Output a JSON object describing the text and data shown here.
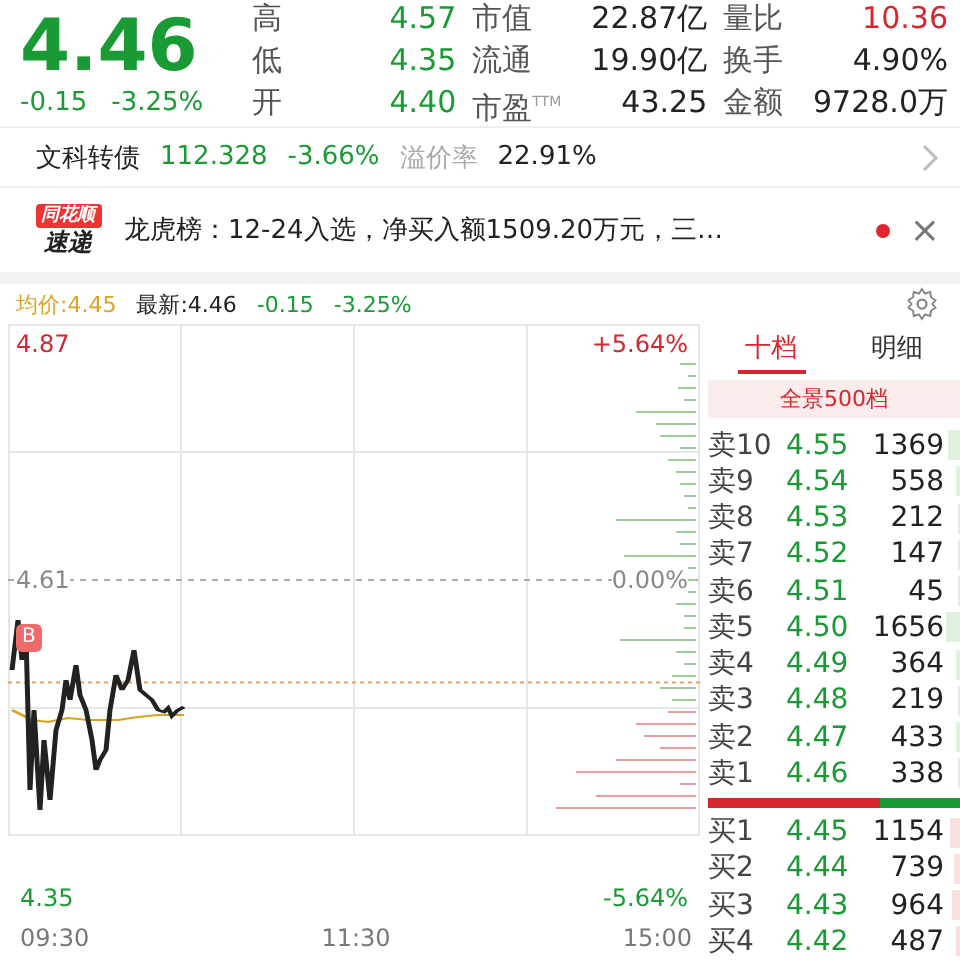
{
  "quote": {
    "price": "4.46",
    "change": "-0.15",
    "change_pct": "-3.25%",
    "stats": [
      {
        "label": "高",
        "value": "4.57",
        "color": "#1a9a35"
      },
      {
        "label": "市值",
        "value": "22.87亿",
        "color": "#222222"
      },
      {
        "label": "量比",
        "value": "10.36",
        "color": "#d8262f"
      },
      {
        "label": "低",
        "value": "4.35",
        "color": "#1a9a35"
      },
      {
        "label": "流通",
        "value": "19.90亿",
        "color": "#222222"
      },
      {
        "label": "换手",
        "value": "4.90%",
        "color": "#222222"
      },
      {
        "label": "开",
        "value": "4.40",
        "color": "#1a9a35"
      },
      {
        "label": "市盈$^{TTM}$",
        "value": "43.25",
        "color": "#222222"
      },
      {
        "label": "金额",
        "value": "9728.0万",
        "color": "#222222"
      }
    ]
  },
  "bond": {
    "name": "文科转债",
    "price": "112.328",
    "change_pct": "-3.66%",
    "premium_label": "溢价率",
    "premium": "22.91%"
  },
  "news": {
    "badge_top": "同花顺",
    "badge_bottom": "速递",
    "text": "龙虎榜：12-24入选，净买入额1509.20万元，三…",
    "unread": true,
    "close": "×"
  },
  "chart_header": {
    "avg": "均价:4.45",
    "latest": "最新:4.46",
    "change": "-0.15",
    "change_pct": "-3.25%"
  },
  "chart": {
    "high": "4.87",
    "high_pct": "+5.64%",
    "base": "4.61",
    "base_pct": "0.00%",
    "low": "4.35",
    "low_pct": "-5.64%",
    "marker": "B",
    "times": [
      "09:30",
      "11:30",
      "15:00"
    ]
  },
  "order_book": {
    "tabs": [
      {
        "label": "十档",
        "selected": true
      },
      {
        "label": "明细",
        "selected": false
      }
    ],
    "depth_button": "全景500档",
    "asks": [
      {
        "label": "卖10",
        "price": "4.55",
        "volume": "1369"
      },
      {
        "label": "卖9",
        "price": "4.54",
        "volume": "558"
      },
      {
        "label": "卖8",
        "price": "4.53",
        "volume": "212"
      },
      {
        "label": "卖7",
        "price": "4.52",
        "volume": "147"
      },
      {
        "label": "卖6",
        "price": "4.51",
        "volume": "45"
      },
      {
        "label": "卖5",
        "price": "4.50",
        "volume": "1656"
      },
      {
        "label": "卖4",
        "price": "4.49",
        "volume": "364"
      },
      {
        "label": "卖3",
        "price": "4.48",
        "volume": "219"
      },
      {
        "label": "卖2",
        "price": "4.47",
        "volume": "433"
      },
      {
        "label": "卖1",
        "price": "4.46",
        "volume": "338"
      }
    ],
    "balance": {
      "level": 0.68
    },
    "bids": [
      {
        "label": "买1",
        "price": "4.45",
        "volume": "1154"
      },
      {
        "label": "买2",
        "price": "4.44",
        "volume": "739"
      },
      {
        "label": "买3",
        "price": "4.43",
        "volume": "964"
      },
      {
        "label": "买4",
        "price": "4.42",
        "volume": "487"
      }
    ]
  }
}
